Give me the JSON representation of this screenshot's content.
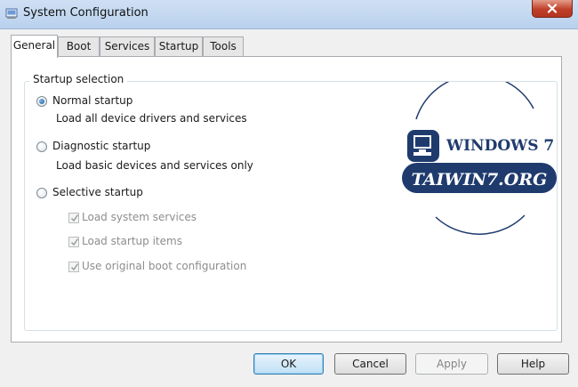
{
  "window": {
    "title": "System Configuration",
    "icon": "msconfig-icon",
    "close_icon": "close-x-icon"
  },
  "tabs": [
    {
      "label": "General",
      "selected": true
    },
    {
      "label": "Boot",
      "selected": false
    },
    {
      "label": "Services",
      "selected": false
    },
    {
      "label": "Startup",
      "selected": false
    },
    {
      "label": "Tools",
      "selected": false
    }
  ],
  "general": {
    "group_title": "Startup selection",
    "normal": {
      "label": "Normal startup",
      "description": "Load all device drivers and services",
      "selected": true
    },
    "diagnostic": {
      "label": "Diagnostic startup",
      "description": "Load basic devices and services only",
      "selected": false
    },
    "selective": {
      "label": "Selective startup",
      "selected": false,
      "options": [
        {
          "label": "Load system services",
          "checked": true,
          "enabled": false
        },
        {
          "label": "Load startup items",
          "checked": true,
          "enabled": false
        },
        {
          "label": "Use original boot configuration",
          "checked": true,
          "enabled": false
        }
      ]
    }
  },
  "watermark": {
    "line1": "WINDOWS 7",
    "line2": "TAIWIN7.ORG",
    "brand_color": "#1f3b6e"
  },
  "buttons": {
    "ok": "OK",
    "cancel": "Cancel",
    "apply": "Apply",
    "help": "Help"
  },
  "colors": {
    "titlebar": "#c4d8f1",
    "close_button": "#c0402a",
    "default_button": "#bfe0f6"
  }
}
